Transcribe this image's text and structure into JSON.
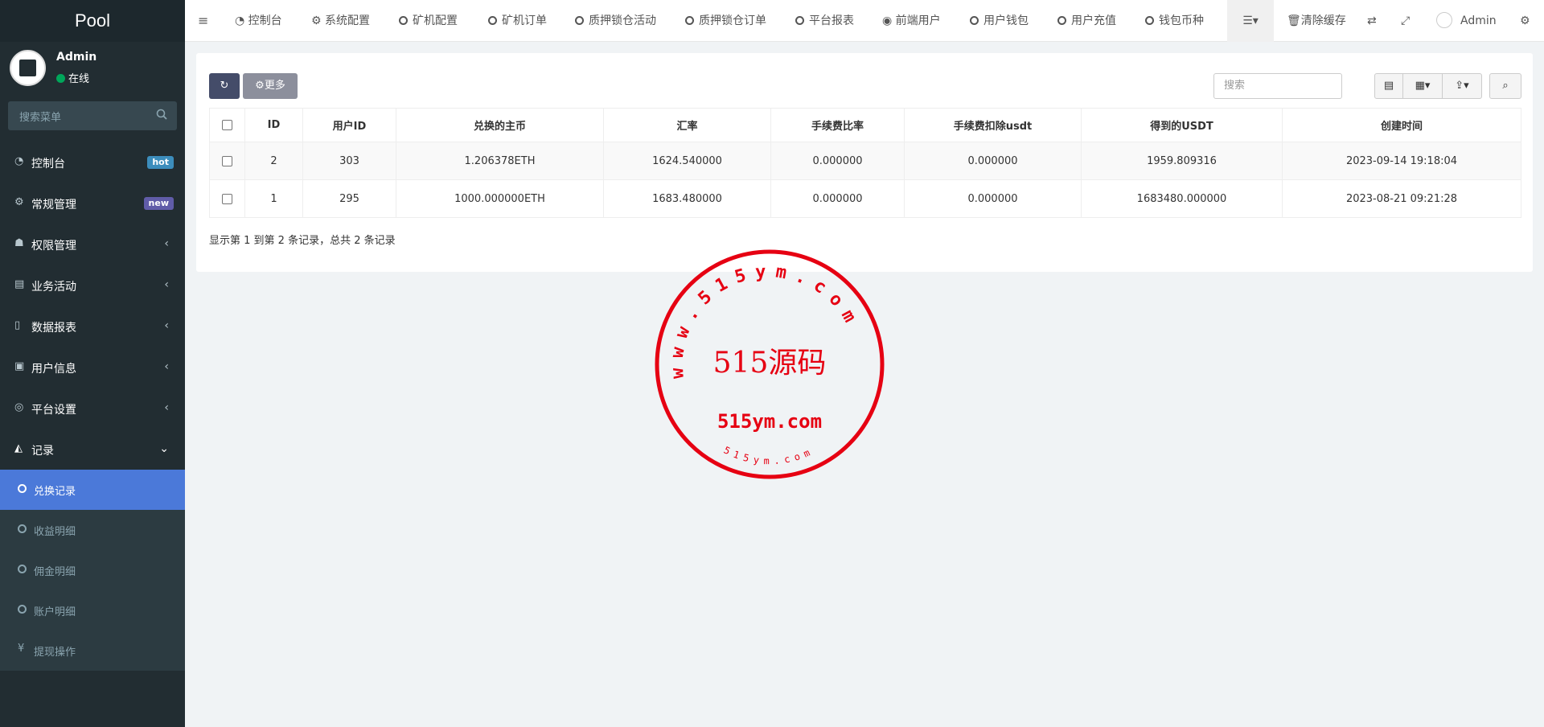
{
  "sidebar": {
    "brand": "Pool",
    "user": {
      "name": "Admin",
      "status": "在线"
    },
    "search_placeholder": "搜索菜单",
    "menu": [
      {
        "label": "控制台",
        "icon": "dashboard-icon",
        "badge": "hot",
        "badge_color": "#3c8dbc"
      },
      {
        "label": "常规管理",
        "icon": "cogs-icon",
        "badge": "new",
        "badge_color": "#605ca8"
      },
      {
        "label": "权限管理",
        "icon": "group-icon"
      },
      {
        "label": "业务活动",
        "icon": "list-alt-icon"
      },
      {
        "label": "数据报表",
        "icon": "file-icon"
      },
      {
        "label": "用户信息",
        "icon": "address-book-icon"
      },
      {
        "label": "平台设置",
        "icon": "cog-circle-icon"
      },
      {
        "label": "记录",
        "icon": "area-chart-icon",
        "expanded": true
      }
    ],
    "submenu": [
      {
        "label": "兑换记录",
        "active": true
      },
      {
        "label": "收益明细"
      },
      {
        "label": "佣金明细"
      },
      {
        "label": "账户明细"
      },
      {
        "label": "提现操作",
        "icon": "yen-icon"
      }
    ]
  },
  "topbar": {
    "tabs": [
      {
        "label": "控制台",
        "icon": "dashboard-icon"
      },
      {
        "label": "系统配置",
        "icon": "cog-icon"
      },
      {
        "label": "矿机配置",
        "icon": "circle-icon"
      },
      {
        "label": "矿机订单",
        "icon": "circle-icon"
      },
      {
        "label": "质押锁仓活动",
        "icon": "circle-icon"
      },
      {
        "label": "质押锁仓订单",
        "icon": "circle-icon"
      },
      {
        "label": "平台报表",
        "icon": "circle-icon"
      },
      {
        "label": "前端用户",
        "icon": "user-circle-icon"
      },
      {
        "label": "用户钱包",
        "icon": "circle-icon"
      },
      {
        "label": "用户充值",
        "icon": "circle-icon"
      },
      {
        "label": "钱包币种",
        "icon": "circle-icon"
      }
    ],
    "clear_cache": "清除缓存",
    "admin": "Admin"
  },
  "toolbar": {
    "more_label": "更多",
    "search_placeholder": "搜索"
  },
  "table": {
    "columns": [
      "ID",
      "用户ID",
      "兑换的主币",
      "汇率",
      "手续费比率",
      "手续费扣除usdt",
      "得到的USDT",
      "创建时间"
    ],
    "rows": [
      [
        "2",
        "303",
        "1.206378ETH",
        "1624.540000",
        "0.000000",
        "0.000000",
        "1959.809316",
        "2023-09-14 19:18:04"
      ],
      [
        "1",
        "295",
        "1000.000000ETH",
        "1683.480000",
        "0.000000",
        "0.000000",
        "1683480.000000",
        "2023-08-21 09:21:28"
      ]
    ]
  },
  "pagination_info": "显示第 1 到第 2 条记录，总共 2 条记录",
  "watermark": {
    "top_arc": "www.515ym.com",
    "center": "515源码",
    "domain": "515ym.com",
    "bottom_arc": "515ym.com",
    "color": "#e60012"
  }
}
